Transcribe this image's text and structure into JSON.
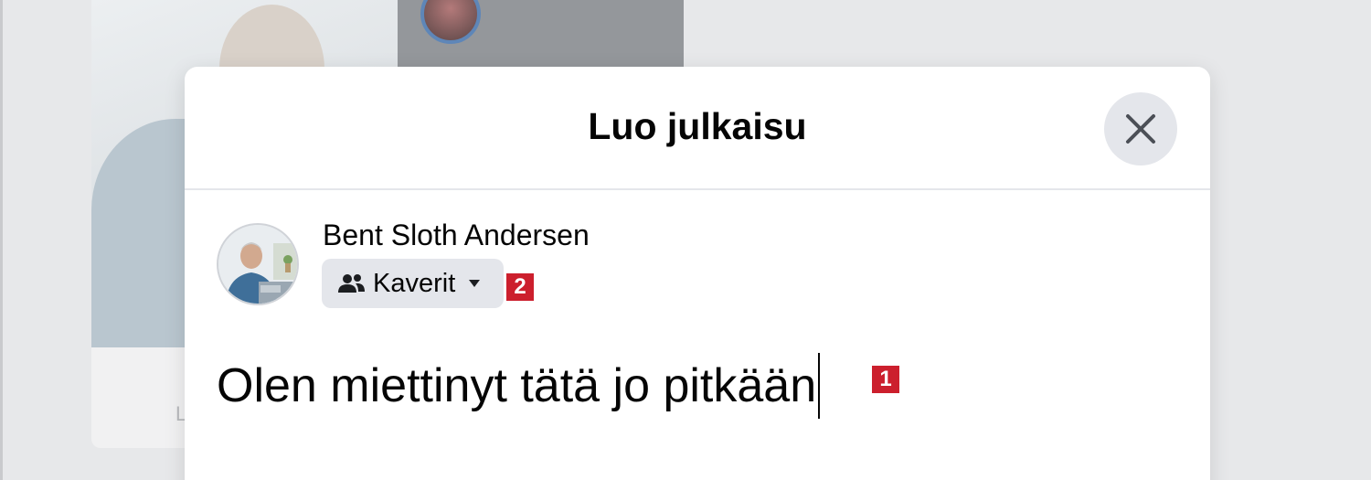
{
  "background": {
    "card_caption": "L"
  },
  "modal": {
    "title": "Luo julkaisu",
    "close_icon": "close-icon"
  },
  "author": {
    "name": "Bent Sloth Andersen",
    "avatar_icon": "avatar"
  },
  "audience": {
    "label": "Kaverit",
    "icon": "friends-icon",
    "caret_icon": "caret-down-icon"
  },
  "composer": {
    "text": "Olen miettinyt tätä jo pitkään"
  },
  "markers": {
    "audience_marker": "2",
    "text_marker": "1"
  },
  "colors": {
    "marker": "#cc1f2d",
    "button_gray": "#e4e6eb",
    "text": "#050505"
  }
}
